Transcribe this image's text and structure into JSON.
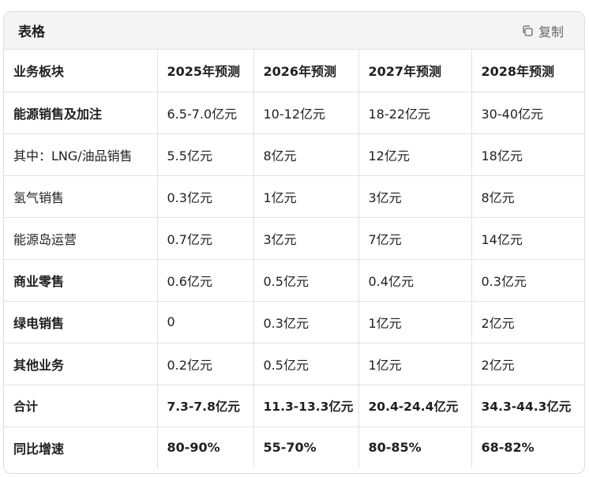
{
  "card": {
    "title": "表格",
    "copy_label": "复制",
    "copy_icon": "copy-icon"
  },
  "table": {
    "headers": [
      "业务板块",
      "2025年预测",
      "2026年预测",
      "2027年预测",
      "2028年预测"
    ],
    "rows": [
      {
        "cells": [
          "能源销售及加注",
          "6.5-7.0亿元",
          "10-12亿元",
          "18-22亿元",
          "30-40亿元"
        ],
        "first_bold": true
      },
      {
        "cells": [
          "其中：LNG/油品销售",
          "5.5亿元",
          "8亿元",
          "12亿元",
          "18亿元"
        ],
        "first_bold": false
      },
      {
        "cells": [
          "氢气销售",
          "0.3亿元",
          "1亿元",
          "3亿元",
          "8亿元"
        ],
        "first_bold": false
      },
      {
        "cells": [
          "能源岛运营",
          "0.7亿元",
          "3亿元",
          "7亿元",
          "14亿元"
        ],
        "first_bold": false
      },
      {
        "cells": [
          "商业零售",
          "0.6亿元",
          "0.5亿元",
          "0.4亿元",
          "0.3亿元"
        ],
        "first_bold": true
      },
      {
        "cells": [
          "绿电销售",
          "0",
          "0.3亿元",
          "1亿元",
          "2亿元"
        ],
        "first_bold": true
      },
      {
        "cells": [
          "其他业务",
          "0.2亿元",
          "0.5亿元",
          "1亿元",
          "2亿元"
        ],
        "first_bold": true
      },
      {
        "cells": [
          "合计",
          "7.3-7.8亿元",
          "11.3-13.3亿元",
          "20.4-24.4亿元",
          "34.3-44.3亿元"
        ],
        "all_bold": true
      },
      {
        "cells": [
          "同比增速",
          "80-90%",
          "55-70%",
          "80-85%",
          "68-82%"
        ],
        "all_bold": true
      }
    ]
  }
}
